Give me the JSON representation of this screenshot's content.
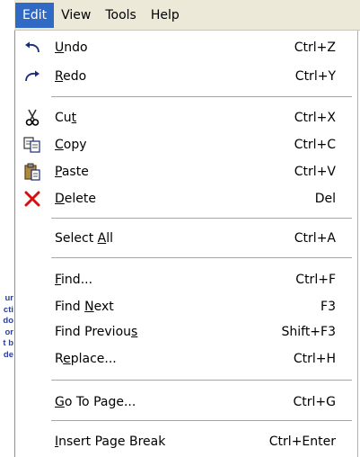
{
  "background_fragments": [
    "ur",
    "cti",
    "do",
    "or",
    "t b",
    "de"
  ],
  "menubar": {
    "items": [
      {
        "label": "Edit",
        "active": true
      },
      {
        "label": "View"
      },
      {
        "label": "Tools"
      },
      {
        "label": "Help"
      }
    ]
  },
  "menu": {
    "groups": [
      [
        {
          "pre": "",
          "mnemonic": "U",
          "post": "ndo",
          "shortcut": "Ctrl+Z",
          "icon": "undo-icon"
        },
        {
          "pre": "",
          "mnemonic": "R",
          "post": "edo",
          "shortcut": "Ctrl+Y",
          "icon": "redo-icon"
        }
      ],
      [
        {
          "pre": "Cu",
          "mnemonic": "t",
          "post": "",
          "shortcut": "Ctrl+X",
          "icon": "cut-icon"
        },
        {
          "pre": "",
          "mnemonic": "C",
          "post": "opy",
          "shortcut": "Ctrl+C",
          "icon": "copy-icon"
        },
        {
          "pre": "",
          "mnemonic": "P",
          "post": "aste",
          "shortcut": "Ctrl+V",
          "icon": "paste-icon"
        },
        {
          "pre": "",
          "mnemonic": "D",
          "post": "elete",
          "shortcut": "Del",
          "icon": "delete-icon"
        }
      ],
      [
        {
          "pre": "Select ",
          "mnemonic": "A",
          "post": "ll",
          "shortcut": "Ctrl+A",
          "icon": ""
        }
      ],
      [
        {
          "pre": "",
          "mnemonic": "F",
          "post": "ind...",
          "shortcut": "Ctrl+F",
          "icon": ""
        },
        {
          "pre": "Find ",
          "mnemonic": "N",
          "post": "ext",
          "shortcut": "F3",
          "icon": ""
        },
        {
          "pre": "Find Previou",
          "mnemonic": "s",
          "post": "",
          "shortcut": "Shift+F3",
          "icon": ""
        },
        {
          "pre": "R",
          "mnemonic": "e",
          "post": "place...",
          "shortcut": "Ctrl+H",
          "icon": ""
        }
      ],
      [
        {
          "pre": "",
          "mnemonic": "G",
          "post": "o To Page...",
          "shortcut": "Ctrl+G",
          "icon": ""
        }
      ],
      [
        {
          "pre": "",
          "mnemonic": "I",
          "post": "nsert Page Break",
          "shortcut": "Ctrl+Enter",
          "icon": ""
        }
      ]
    ]
  }
}
